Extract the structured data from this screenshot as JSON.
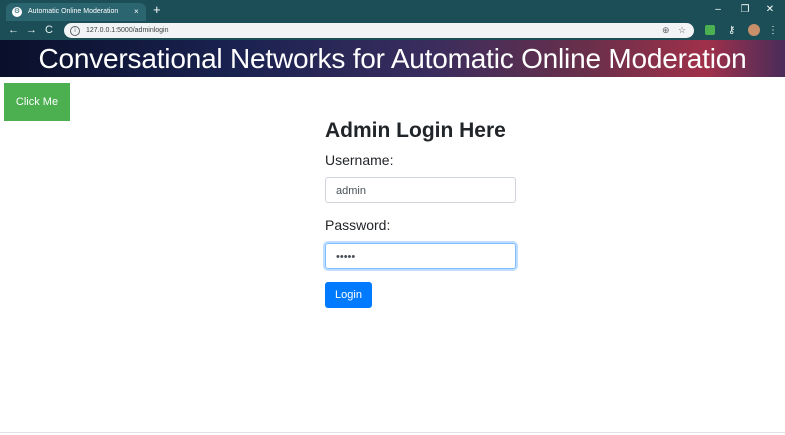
{
  "browser": {
    "tab_title": "Automatic Online Moderation",
    "tab_close": "×",
    "new_tab": "+",
    "url": "127.0.0.1:5000/adminlogin",
    "window_controls": {
      "minimize": "–",
      "restore": "❐",
      "close": "✕"
    },
    "icons": [
      "back-icon",
      "forward-icon",
      "reload-icon",
      "info-icon",
      "zoom-icon",
      "star-icon",
      "sheets-icon",
      "key-icon",
      "avatar",
      "menu-icon"
    ]
  },
  "banner": {
    "title": "Conversational Networks for Automatic Online Moderation"
  },
  "click_me": {
    "label": "Click Me"
  },
  "form": {
    "heading": "Admin Login Here",
    "username_label": "Username:",
    "username_value": "admin",
    "password_label": "Password:",
    "password_value": "•••••",
    "login_label": "Login"
  },
  "colors": {
    "browser_frame": "#1b4e57",
    "click_me": "#4caf50",
    "login_button": "#007bff",
    "focus_ring": "#80bdff"
  }
}
